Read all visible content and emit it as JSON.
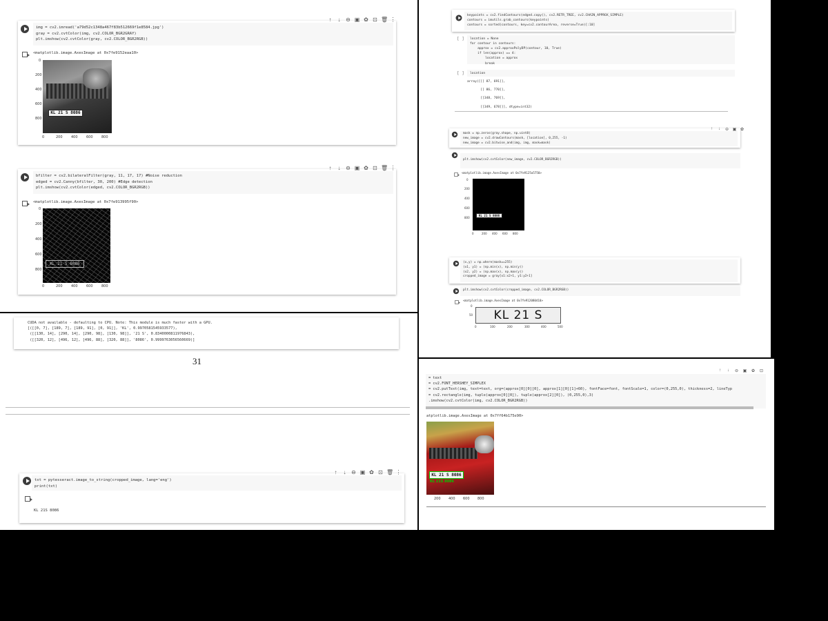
{
  "page1": {
    "cell1": {
      "code": [
        "img = cv2.imread('a79d52c1348a467f83b512669f1e8584.jpg')",
        "gray = cv2.cvtColor(img, cv2.COLOR_BGR2GRAY)",
        "plt.imshow(cv2.cvtColor(gray, cv2.COLOR_BGR2RGB))"
      ],
      "output": "<matplotlib.image.AxesImage at 0x7fe9152eaa10>",
      "yticks": [
        "0",
        "200",
        "400",
        "600",
        "800"
      ],
      "xticks": [
        "0",
        "200",
        "400",
        "600",
        "800"
      ],
      "plate": "KL 21 S 8086"
    },
    "cell2": {
      "code": [
        "bfilter = cv2.bilateralFilter(gray, 11, 17, 17) #Noise reduction",
        "edged = cv2.Canny(bfilter, 30, 200) #Edge detection",
        "plt.imshow(cv2.cvtColor(edged, cv2.COLOR_BGR2RGB))"
      ],
      "output": "<matplotlib.image.AxesImage at 0x7fe913995f90>",
      "yticks": [
        "0",
        "200",
        "400",
        "600",
        "800"
      ],
      "xticks": [
        "0",
        "200",
        "400",
        "600",
        "800"
      ],
      "plate": "KL 21 S 8086"
    },
    "toolbar": [
      "↑",
      "↓",
      "⊖",
      "▣",
      "✿",
      "⊡",
      "🗑",
      "⋮"
    ]
  },
  "ocr_output": [
    "CUDA not available - defaulting to CPU. Note: This module is much faster with a GPU.",
    "[([[0, 7], [189, 7], [189, 91], [0, 91]], 'KL', 0.9970581545933577),",
    " ([[130, 14], [290, 14], [290, 98], [130, 98]], '21 S', 0.8340000811976843),",
    " ([[320, 12], [496, 12], [496, 88], [320, 88]], '8086', 0.9999763056560669)]"
  ],
  "page_number": "31",
  "page2": {
    "cell_tesseract": {
      "code": [
        "txt = pytesseract.image_to_string(cropped_image, lang='eng')",
        "print(txt)"
      ],
      "output": "KL 21S 8086"
    }
  },
  "page3": {
    "cell_contours": {
      "code": [
        "keypoints = cv2.findContours(edged.copy(), cv2.RETR_TREE, cv2.CHAIN_APPROX_SIMPLE)",
        "contours = imutils.grab_contours(keypoints)",
        "contours = sorted(contours, key=cv2.contourArea, reverse=True)[:10]"
      ]
    },
    "cell_location": {
      "bracket": "[ ]",
      "code": [
        "location = None",
        "for contour in contours:",
        "    approx = cv2.approxPolyDP(contour, 10, True)",
        "    if len(approx) == 4:",
        "        location = approx",
        "        break"
      ]
    },
    "cell_location_print": {
      "bracket": "[ ]",
      "code": [
        "location"
      ],
      "output": [
        "array([[[ 87, 691]],",
        "",
        "       [[ 86, 770]],",
        "",
        "       [[348, 769]],",
        "",
        "       [[349, 678]]], dtype=int32)"
      ]
    },
    "cell_mask": {
      "code": [
        "mask = np.zeros(gray.shape, np.uint8)",
        "new_image = cv2.drawContours(mask, [location], 0,255, -1)",
        "new_image = cv2.bitwise_and(img, img, mask=mask)"
      ]
    },
    "cell_show_mask": {
      "code": [
        "plt.imshow(cv2.cvtColor(new_image, cv2.COLOR_BGR2RGB))"
      ],
      "output": "<matplotlib.image.AxesImage at 0x7fe9125a5750>",
      "yticks": [
        "0",
        "200",
        "400",
        "600",
        "800"
      ],
      "xticks": [
        "0",
        "200",
        "400",
        "600",
        "800"
      ],
      "plate": "KL 21 S 8086"
    },
    "cell_crop": {
      "code": [
        "(x,y) = np.where(mask==255)",
        "(x1, y1) = (np.min(x), np.min(y))",
        "(x2, y2) = (np.max(x), np.max(y))",
        "cropped_image = gray[x1:x2+1, y1:y2+1]"
      ]
    },
    "cell_show_crop": {
      "code": [
        "plt.imshow(cv2.cvtColor(cropped_image, cv2.COLOR_BGR2RGB))"
      ],
      "output": "<matplotlib.image.AxesImage at 0x7fe912080410>",
      "yticks": [
        "0",
        "50"
      ],
      "xticks": [
        "0",
        "100",
        "200",
        "300",
        "400",
        "500"
      ],
      "plate": "KL 21 S 8086"
    }
  },
  "page4": {
    "code": [
      "= text",
      "= cv2.FONT_HERSHEY_SIMPLEX",
      "= cv2.putText(img, text=text, org=(approx[0][0][0], approx[1][0][1]+60), fontFace=font, fontScale=1, color=(0,255,0), thickness=2, lineTyp",
      "= cv2.rectangle(img, tuple(approx[0][0]), tuple(approx[2][0]), (0,255,0),3)",
      ".imshow(cv2.cvtColor(img, cv2.COLOR_BGR2RGB))"
    ],
    "output": "atplotlib.image.AxesImage at 0x7ff64b175e90>",
    "xticks": [
      "200",
      "400",
      "600",
      "800"
    ],
    "plate": "KL 21 S 8086",
    "overlay_text": "KL 21S 8086"
  },
  "colors": {
    "code_bg": "#f7f7f7",
    "green_overlay": "#00c800"
  }
}
